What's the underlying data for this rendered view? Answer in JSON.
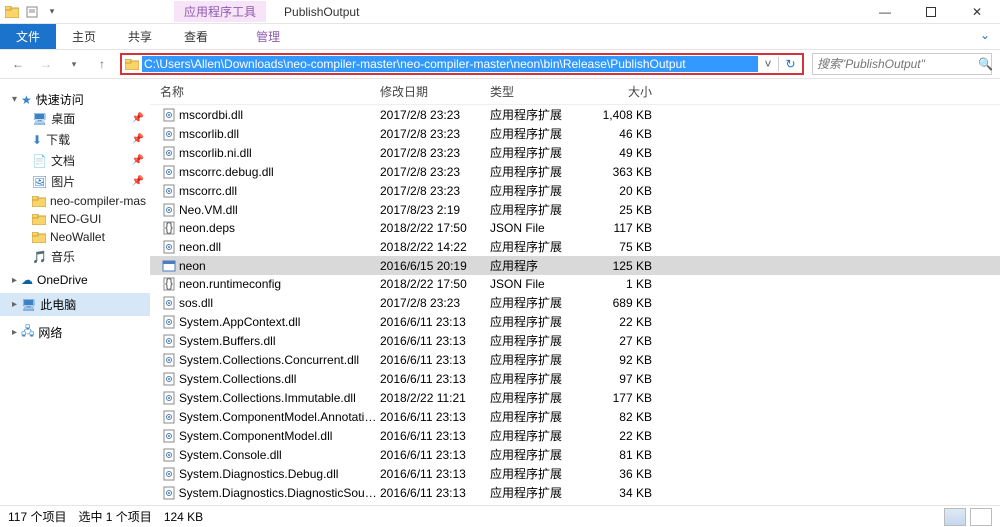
{
  "window": {
    "tools_tab": "应用程序工具",
    "title": "PublishOutput"
  },
  "ribbon": {
    "file": "文件",
    "tabs": [
      "主页",
      "共享",
      "查看"
    ],
    "context_tab": "管理"
  },
  "address": {
    "path": "C:\\Users\\Allen\\Downloads\\neo-compiler-master\\neo-compiler-master\\neon\\bin\\Release\\PublishOutput"
  },
  "search": {
    "placeholder": "搜索\"PublishOutput\""
  },
  "sidebar": {
    "quick_access": "快速访问",
    "items": [
      {
        "label": "桌面",
        "pinned": true
      },
      {
        "label": "下载",
        "pinned": true
      },
      {
        "label": "文档",
        "pinned": true
      },
      {
        "label": "图片",
        "pinned": true
      },
      {
        "label": "neo-compiler-mas",
        "pinned": false
      },
      {
        "label": "NEO-GUI",
        "pinned": false
      },
      {
        "label": "NeoWallet",
        "pinned": false
      },
      {
        "label": "音乐",
        "pinned": false
      }
    ],
    "onedrive": "OneDrive",
    "thispc": "此电脑",
    "network": "网络"
  },
  "columns": {
    "name": "名称",
    "date": "修改日期",
    "type": "类型",
    "size": "大小"
  },
  "files": [
    {
      "icon": "dll",
      "name": "mscordbi.dll",
      "date": "2017/2/8 23:23",
      "type": "应用程序扩展",
      "size": "1,408 KB"
    },
    {
      "icon": "dll",
      "name": "mscorlib.dll",
      "date": "2017/2/8 23:23",
      "type": "应用程序扩展",
      "size": "46 KB"
    },
    {
      "icon": "dll",
      "name": "mscorlib.ni.dll",
      "date": "2017/2/8 23:23",
      "type": "应用程序扩展",
      "size": "49 KB"
    },
    {
      "icon": "dll",
      "name": "mscorrc.debug.dll",
      "date": "2017/2/8 23:23",
      "type": "应用程序扩展",
      "size": "363 KB"
    },
    {
      "icon": "dll",
      "name": "mscorrc.dll",
      "date": "2017/2/8 23:23",
      "type": "应用程序扩展",
      "size": "20 KB"
    },
    {
      "icon": "dll",
      "name": "Neo.VM.dll",
      "date": "2017/8/23 2:19",
      "type": "应用程序扩展",
      "size": "25 KB"
    },
    {
      "icon": "json",
      "name": "neon.deps",
      "date": "2018/2/22 17:50",
      "type": "JSON File",
      "size": "117 KB"
    },
    {
      "icon": "dll",
      "name": "neon.dll",
      "date": "2018/2/22 14:22",
      "type": "应用程序扩展",
      "size": "75 KB"
    },
    {
      "icon": "exe",
      "name": "neon",
      "date": "2016/6/15 20:19",
      "type": "应用程序",
      "size": "125 KB",
      "selected": true
    },
    {
      "icon": "json",
      "name": "neon.runtimeconfig",
      "date": "2018/2/22 17:50",
      "type": "JSON File",
      "size": "1 KB"
    },
    {
      "icon": "dll",
      "name": "sos.dll",
      "date": "2017/2/8 23:23",
      "type": "应用程序扩展",
      "size": "689 KB"
    },
    {
      "icon": "dll",
      "name": "System.AppContext.dll",
      "date": "2016/6/11 23:13",
      "type": "应用程序扩展",
      "size": "22 KB"
    },
    {
      "icon": "dll",
      "name": "System.Buffers.dll",
      "date": "2016/6/11 23:13",
      "type": "应用程序扩展",
      "size": "27 KB"
    },
    {
      "icon": "dll",
      "name": "System.Collections.Concurrent.dll",
      "date": "2016/6/11 23:13",
      "type": "应用程序扩展",
      "size": "92 KB"
    },
    {
      "icon": "dll",
      "name": "System.Collections.dll",
      "date": "2016/6/11 23:13",
      "type": "应用程序扩展",
      "size": "97 KB"
    },
    {
      "icon": "dll",
      "name": "System.Collections.Immutable.dll",
      "date": "2018/2/22 11:21",
      "type": "应用程序扩展",
      "size": "177 KB"
    },
    {
      "icon": "dll",
      "name": "System.ComponentModel.Annotatio...",
      "date": "2016/6/11 23:13",
      "type": "应用程序扩展",
      "size": "82 KB"
    },
    {
      "icon": "dll",
      "name": "System.ComponentModel.dll",
      "date": "2016/6/11 23:13",
      "type": "应用程序扩展",
      "size": "22 KB"
    },
    {
      "icon": "dll",
      "name": "System.Console.dll",
      "date": "2016/6/11 23:13",
      "type": "应用程序扩展",
      "size": "81 KB"
    },
    {
      "icon": "dll",
      "name": "System.Diagnostics.Debug.dll",
      "date": "2016/6/11 23:13",
      "type": "应用程序扩展",
      "size": "36 KB"
    },
    {
      "icon": "dll",
      "name": "System.Diagnostics.DiagnosticSourc...",
      "date": "2016/6/11 23:13",
      "type": "应用程序扩展",
      "size": "34 KB"
    }
  ],
  "status": {
    "count": "117 个项目",
    "selection": "选中 1 个项目",
    "size": "124 KB"
  }
}
